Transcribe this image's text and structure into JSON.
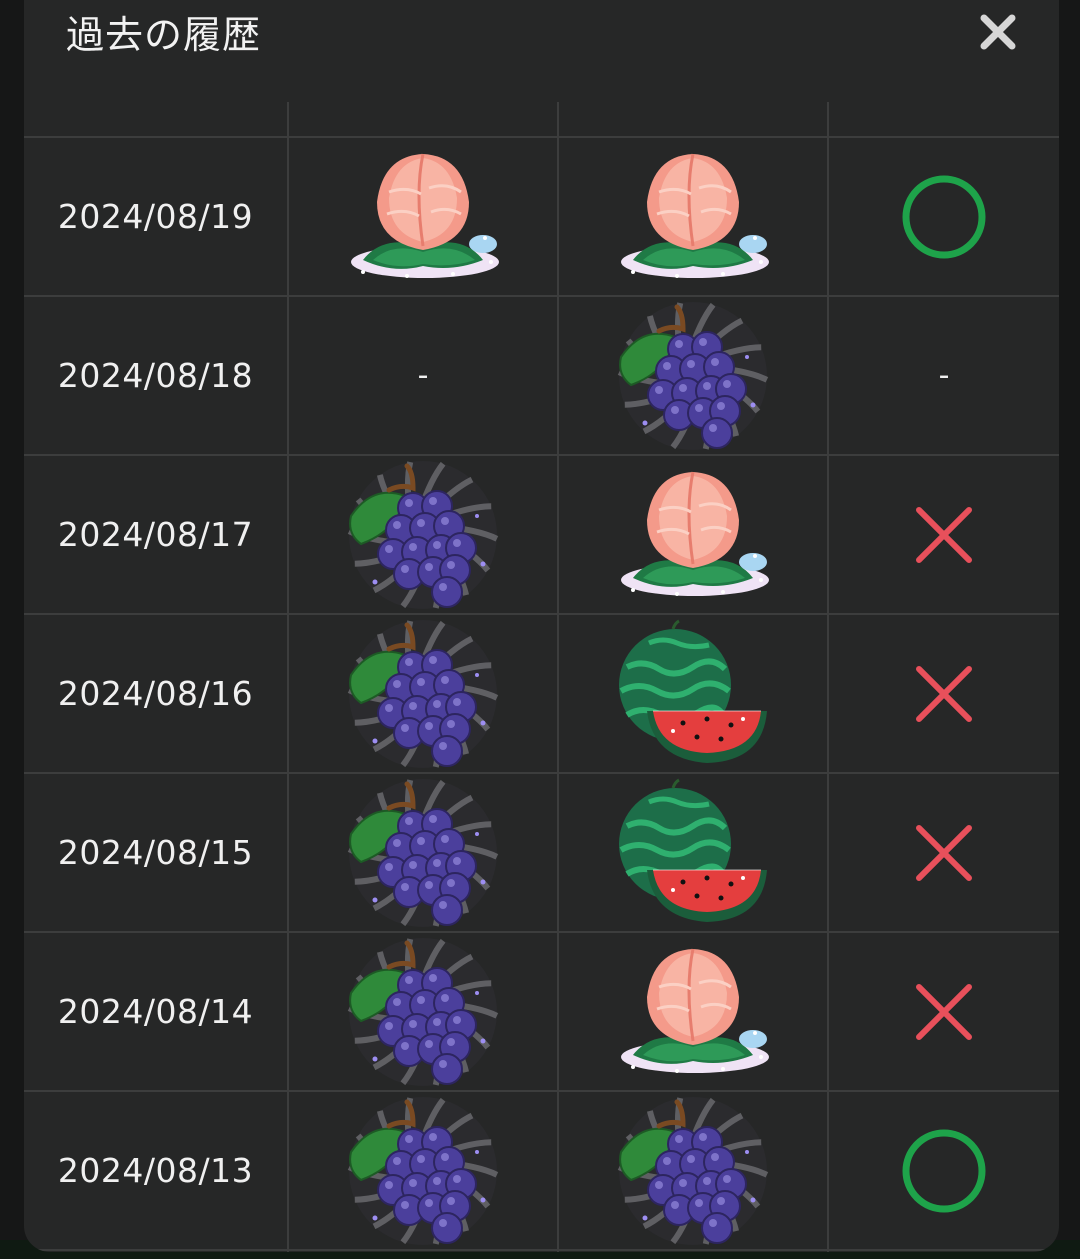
{
  "header": {
    "title": "過去の履歴",
    "close_icon": "close-icon"
  },
  "history": [
    {
      "date": "2024/08/19",
      "prediction": "peach",
      "actual": "peach",
      "result": "correct"
    },
    {
      "date": "2024/08/18",
      "prediction": "-",
      "actual": "grape",
      "result": "-"
    },
    {
      "date": "2024/08/17",
      "prediction": "grape",
      "actual": "peach",
      "result": "wrong"
    },
    {
      "date": "2024/08/16",
      "prediction": "grape",
      "actual": "watermelon",
      "result": "wrong"
    },
    {
      "date": "2024/08/15",
      "prediction": "grape",
      "actual": "watermelon",
      "result": "wrong"
    },
    {
      "date": "2024/08/14",
      "prediction": "grape",
      "actual": "peach",
      "result": "wrong"
    },
    {
      "date": "2024/08/13",
      "prediction": "grape",
      "actual": "grape",
      "result": "correct"
    }
  ],
  "colors": {
    "correct": "#1ea34a",
    "wrong": "#e8505b",
    "background": "#262727",
    "gridline": "#3c3d3d"
  }
}
